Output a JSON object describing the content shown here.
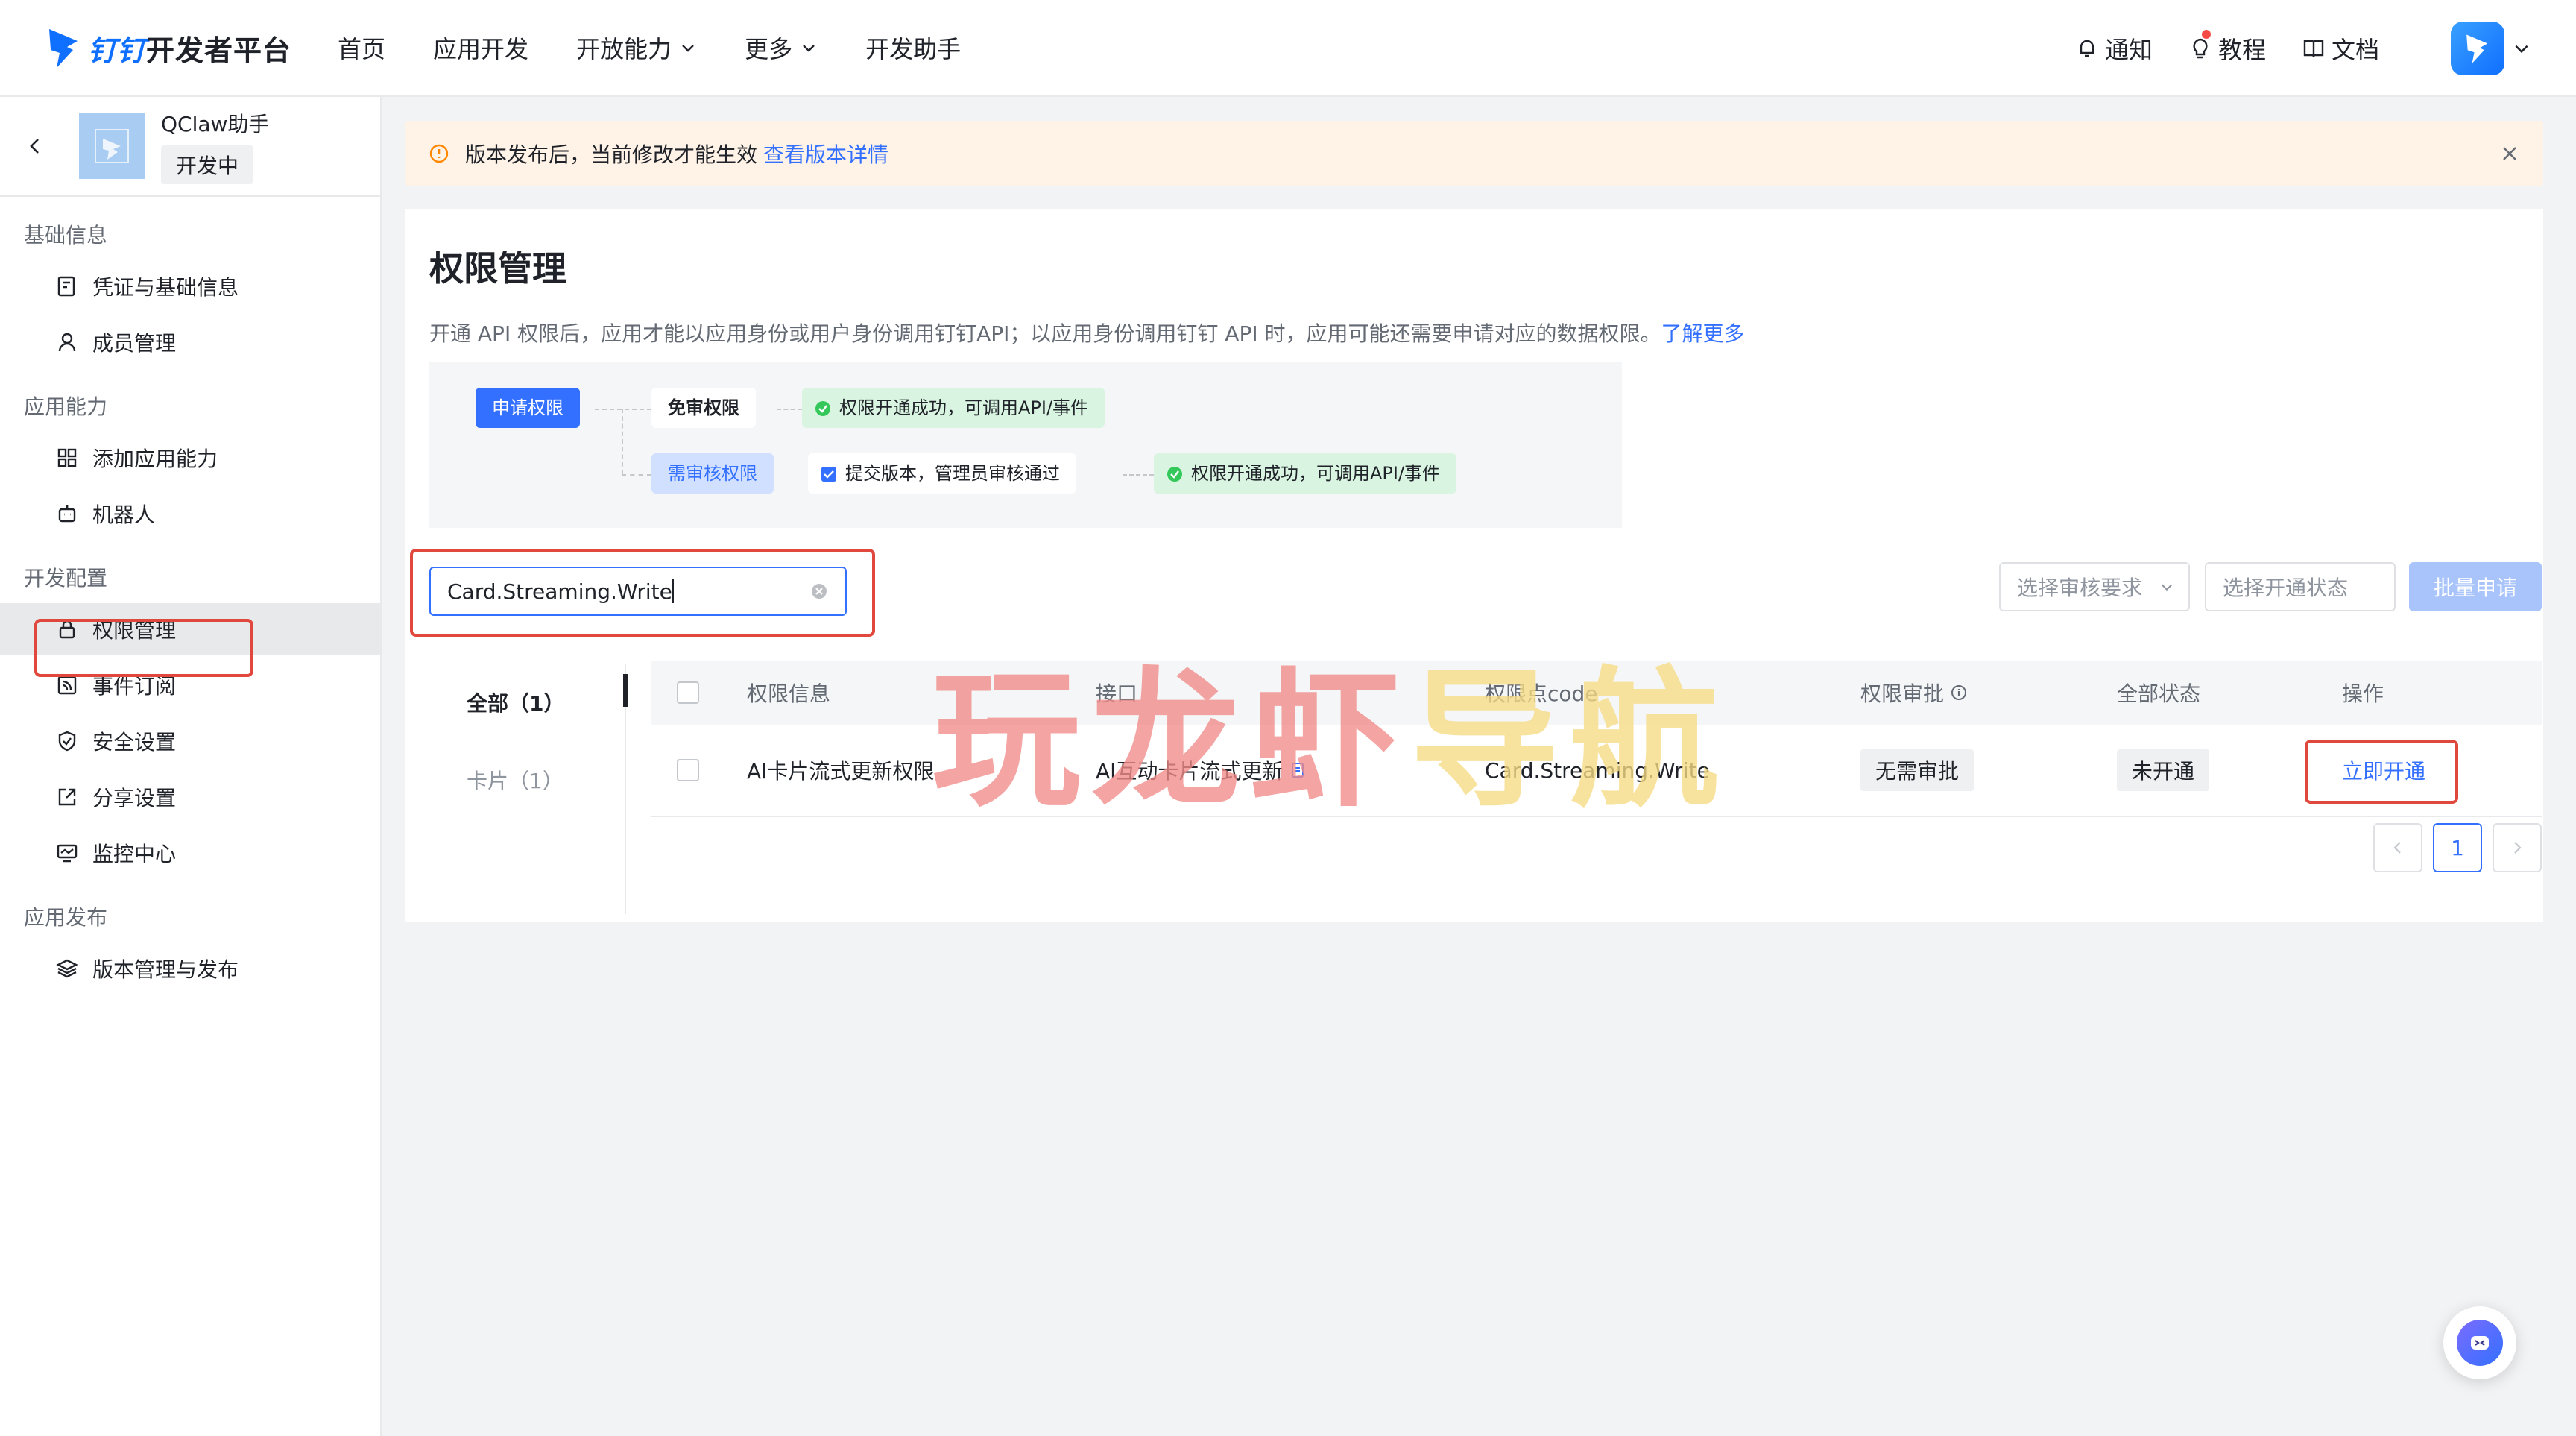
{
  "topnav": {
    "brand_accent": "钉钉",
    "brand_rest": "开发者平台",
    "menu": [
      {
        "label": "首页",
        "has_dropdown": false
      },
      {
        "label": "应用开发",
        "has_dropdown": false
      },
      {
        "label": "开放能力",
        "has_dropdown": true
      },
      {
        "label": "更多",
        "has_dropdown": true
      },
      {
        "label": "开发助手",
        "has_dropdown": false
      }
    ],
    "right": {
      "notify": "通知",
      "tutorial": "教程",
      "docs": "文档"
    }
  },
  "sidebar": {
    "app_name": "QClaw助手",
    "app_status": "开发中",
    "groups": [
      {
        "title": "基础信息",
        "items": [
          {
            "label": "凭证与基础信息",
            "icon": "credential-icon"
          },
          {
            "label": "成员管理",
            "icon": "user-icon"
          }
        ]
      },
      {
        "title": "应用能力",
        "items": [
          {
            "label": "添加应用能力",
            "icon": "grid-icon"
          },
          {
            "label": "机器人",
            "icon": "robot-icon"
          }
        ]
      },
      {
        "title": "开发配置",
        "items": [
          {
            "label": "权限管理",
            "icon": "lock-icon",
            "active": true
          },
          {
            "label": "事件订阅",
            "icon": "subscribe-icon"
          },
          {
            "label": "安全设置",
            "icon": "shield-icon"
          },
          {
            "label": "分享设置",
            "icon": "share-icon"
          },
          {
            "label": "监控中心",
            "icon": "monitor-icon"
          }
        ]
      },
      {
        "title": "应用发布",
        "items": [
          {
            "label": "版本管理与发布",
            "icon": "layers-icon"
          }
        ]
      }
    ]
  },
  "alert": {
    "message": "版本发布后，当前修改才能生效",
    "link": "查看版本详情"
  },
  "page": {
    "title": "权限管理",
    "description": "开通 API 权限后，应用才能以应用身份或用户身份调用钉钉API；以应用身份调用钉钉 API 时，应用可能还需要申请对应的数据权限。",
    "learn_more": "了解更多"
  },
  "flow": {
    "apply": "申请权限",
    "no_review": "免审权限",
    "success_a": "权限开通成功，可调用API/事件",
    "needs_review": "需审核权限",
    "submit_step": "提交版本，管理员审核通过",
    "success_b": "权限开通成功，可调用API/事件"
  },
  "filters": {
    "search_value": "Card.Streaming.Write",
    "review_placeholder": "选择审核要求",
    "status_placeholder": "选择开通状态",
    "bulk_button": "批量申请"
  },
  "tabs": [
    {
      "label": "全部（1）",
      "active": true
    },
    {
      "label": "卡片（1）",
      "active": false
    }
  ],
  "table": {
    "headers": {
      "info": "权限信息",
      "api": "接口",
      "code": "权限点code",
      "approval": "权限审批",
      "status": "全部状态",
      "action": "操作"
    },
    "rows": [
      {
        "info": "AI卡片流式更新权限",
        "api": "AI互动卡片流式更新",
        "code": "Card.Streaming.Write",
        "approval": "无需审批",
        "status": "未开通",
        "action": "立即开通"
      }
    ]
  },
  "pagination": {
    "current": "1"
  },
  "watermark": {
    "part1": "玩龙虾",
    "part2": "导航"
  },
  "colors": {
    "accent": "#3370ff",
    "highlight_box": "#e0483e",
    "alert_bg": "#fff2e6"
  }
}
